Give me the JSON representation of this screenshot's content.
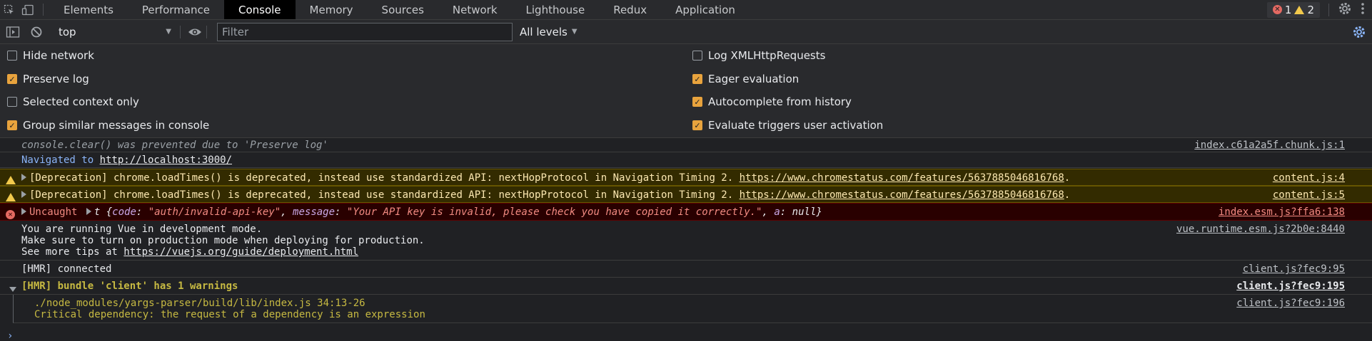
{
  "tabs": [
    {
      "label": "Elements"
    },
    {
      "label": "Performance"
    },
    {
      "label": "Console"
    },
    {
      "label": "Memory"
    },
    {
      "label": "Sources"
    },
    {
      "label": "Network"
    },
    {
      "label": "Lighthouse"
    },
    {
      "label": "Redux"
    },
    {
      "label": "Application"
    }
  ],
  "active_tab": "Console",
  "counts": {
    "errors": "1",
    "warnings": "2"
  },
  "toolbar": {
    "context": "top",
    "filter_placeholder": "Filter",
    "filter_value": "",
    "levels": "All levels"
  },
  "settings": {
    "left": [
      {
        "label": "Hide network",
        "checked": false
      },
      {
        "label": "Preserve log",
        "checked": true
      },
      {
        "label": "Selected context only",
        "checked": false
      },
      {
        "label": "Group similar messages in console",
        "checked": true
      }
    ],
    "right": [
      {
        "label": "Log XMLHttpRequests",
        "checked": false
      },
      {
        "label": "Eager evaluation",
        "checked": true
      },
      {
        "label": "Autocomplete from history",
        "checked": true
      },
      {
        "label": "Evaluate triggers user activation",
        "checked": true
      }
    ]
  },
  "messages": {
    "m1": {
      "text": "console.clear() was prevented due to 'Preserve log'",
      "source": "index.c61a2a5f.chunk.js:1"
    },
    "m2": {
      "prefix": "Navigated to ",
      "url": "http://localhost:3000/"
    },
    "m3": {
      "text": "[Deprecation] chrome.loadTimes() is deprecated, instead use standardized API: nextHopProtocol in Navigation Timing 2. ",
      "url": "https://www.chromestatus.com/features/5637885046816768",
      "suffix": ".",
      "source": "content.js:4"
    },
    "m4": {
      "text": "[Deprecation] chrome.loadTimes() is deprecated, instead use standardized API: nextHopProtocol in Navigation Timing 2. ",
      "url": "https://www.chromestatus.com/features/5637885046816768",
      "suffix": ".",
      "source": "content.js:5"
    },
    "m5": {
      "prefix": "Uncaught ",
      "obj_name": "t",
      "open": " {",
      "k1": "code",
      "v1": "\"auth/invalid-api-key\"",
      "k2": "message",
      "v2": "\"Your API key is invalid, please check you have copied it correctly.\"",
      "k3": "a",
      "v3": "null",
      "close": "}",
      "source": "index.esm.js?ffa6:138"
    },
    "m6": {
      "line1": "You are running Vue in development mode.",
      "line2": "Make sure to turn on production mode when deploying for production.",
      "line3_prefix": "See more tips at ",
      "url": "https://vuejs.org/guide/deployment.html",
      "source": "vue.runtime.esm.js?2b0e:8440"
    },
    "m7": {
      "text": "[HMR] connected",
      "source": "client.js?fec9:95"
    },
    "m8": {
      "text": "[HMR] bundle 'client' has 1 warnings",
      "source": "client.js?fec9:195"
    },
    "m9": {
      "line1": "./node_modules/yargs-parser/build/lib/index.js 34:13-26",
      "line2": "Critical dependency: the request of a dependency is an expression",
      "source": "client.js?fec9:196"
    }
  },
  "icons": {
    "inspect": "inspect-element-icon",
    "device": "device-toolbar-icon",
    "settings": "gear-icon",
    "more": "kebab-menu-icon"
  }
}
